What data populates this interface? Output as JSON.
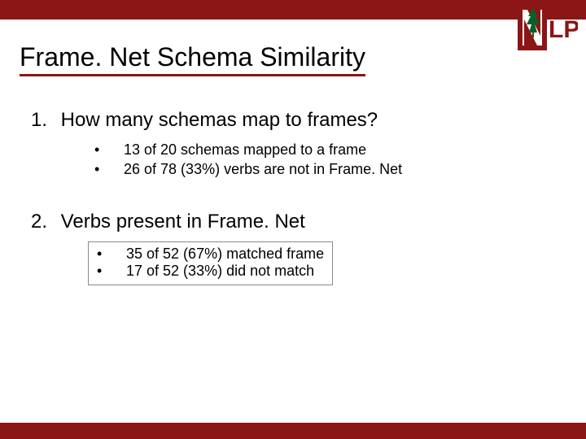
{
  "colors": {
    "accent": "#8c1515"
  },
  "logo": {
    "text": "LP",
    "icon": "stanford-tree-icon"
  },
  "title": "Frame. Net Schema Similarity",
  "items": [
    {
      "number": "1.",
      "question": "How many schemas map to frames?",
      "bullets": [
        "13 of 20 schemas mapped to a frame",
        "26 of 78 (33%) verbs are not in Frame. Net"
      ]
    },
    {
      "number": "2.",
      "question": "Verbs present in Frame. Net",
      "bullets": [
        "35 of 52 (67%) matched frame",
        "17 of 52 (33%) did not match"
      ]
    }
  ]
}
